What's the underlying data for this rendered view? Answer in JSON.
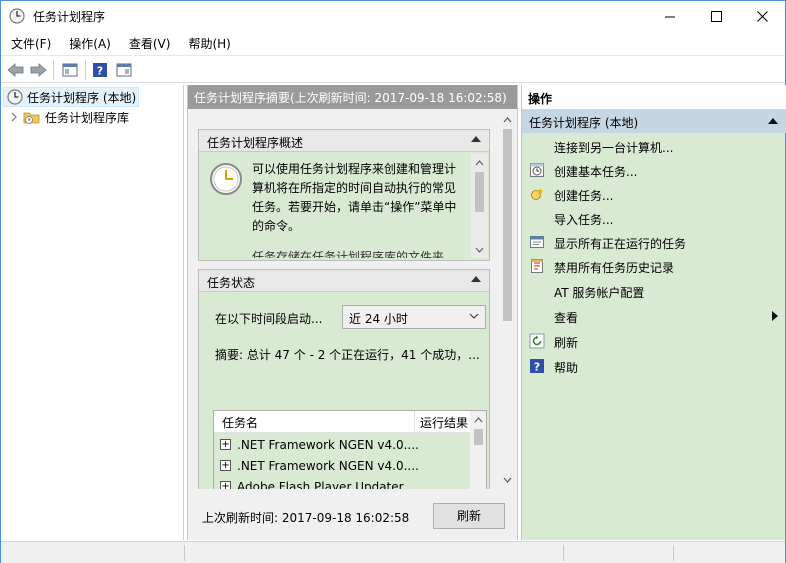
{
  "window": {
    "title": "任务计划程序"
  },
  "menu": {
    "items": [
      "文件(F)",
      "操作(A)",
      "查看(V)",
      "帮助(H)"
    ]
  },
  "toolbar": {
    "buttons": [
      "back-arrow-icon",
      "forward-arrow-icon",
      "show-hide-console-tree-icon",
      "help-icon",
      "show-hide-action-pane-icon"
    ]
  },
  "tree": {
    "root": "任务计划程序 (本地)",
    "child": "任务计划程序库"
  },
  "middle": {
    "header": "任务计划程序摘要(上次刷新时间: 2017-09-18 16:02:58)",
    "overview": {
      "title": "任务计划程序概述",
      "text": "可以使用任务计划程序来创建和管理计算机将在所指定的时间自动执行的常见任务。若要开始，请单击“操作”菜单中的命令。",
      "more": "任务存储在任务计划程序库的文件夹"
    },
    "status": {
      "title": "任务状态",
      "field_label": "在以下时间段启动...",
      "select_value": "近 24 小时",
      "summary": "摘要: 总计 47 个 - 2 个正在运行，41 个成功，..."
    },
    "task_list": {
      "columns": [
        "任务名",
        "运行结果"
      ],
      "rows": [
        ".NET Framework NGEN v4.0....",
        ".NET Framework NGEN v4.0....",
        "Adobe Flash Player Updater ..."
      ]
    },
    "footer": {
      "last_refresh": "上次刷新时间: 2017-09-18 16:02:58",
      "refresh_label": "刷新"
    }
  },
  "actions": {
    "title": "操作",
    "group": "任务计划程序 (本地)",
    "items": [
      {
        "label": "连接到另一台计算机...",
        "icon": ""
      },
      {
        "label": "创建基本任务...",
        "icon": "create-basic-task-icon"
      },
      {
        "label": "创建任务...",
        "icon": "create-task-icon"
      },
      {
        "label": "导入任务...",
        "icon": ""
      },
      {
        "label": "显示所有正在运行的任务",
        "icon": "running-tasks-icon"
      },
      {
        "label": "禁用所有任务历史记录",
        "icon": "task-history-icon"
      },
      {
        "label": "AT 服务帐户配置",
        "icon": ""
      },
      {
        "label": "查看",
        "icon": ""
      },
      {
        "label": "刷新",
        "icon": "refresh-icon"
      },
      {
        "label": "帮助",
        "icon": "help-icon"
      }
    ]
  },
  "colors": {
    "accent_green": "#d9ead3",
    "header_gray": "#9a9a9a",
    "group_blue": "#c5d6e5"
  }
}
